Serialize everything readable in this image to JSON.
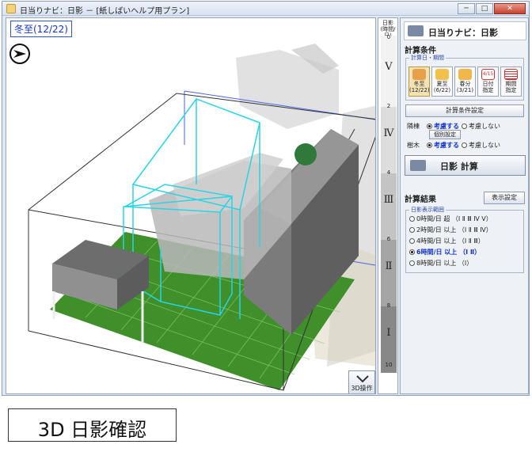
{
  "window": {
    "title": "日当りナビ：日影 － [紙しばいヘルプ用プラン]",
    "buttons": [
      "─",
      "□",
      "✕"
    ]
  },
  "viewport": {
    "date_label": "冬至(12/22)",
    "op_button_label": "3D操作"
  },
  "scale": {
    "header": [
      "日影",
      "(時間/日)"
    ],
    "numbers": [
      "0",
      "2",
      "4",
      "6",
      "8",
      "10"
    ],
    "romans": [
      "Ⅴ",
      "Ⅳ",
      "Ⅲ",
      "Ⅱ",
      "Ⅰ"
    ]
  },
  "panel": {
    "title": "日当りナビ：日影",
    "calc_conditions": {
      "heading": "計算条件",
      "group_label": "計算日・期間",
      "days": [
        {
          "label": "冬至",
          "date": "(12/22)",
          "active": true
        },
        {
          "label": "夏至",
          "date": "(6/22)",
          "active": false
        },
        {
          "label": "春分",
          "date": "(3/21)",
          "active": false
        },
        {
          "label": "日付",
          "date": "指定",
          "active": false
        },
        {
          "label": "期間",
          "date": "指定",
          "active": false
        }
      ],
      "day_icon_text": "4/15",
      "settings_button": "計算条件設定",
      "neighbor": {
        "key": "隣棟",
        "consider": "考慮する",
        "ignore": "考慮しない"
      },
      "individual_button": "個別設定",
      "trees": {
        "key": "樹木",
        "consider": "考慮する",
        "ignore": "考慮しない"
      }
    },
    "calc_button": "日影 計算",
    "results": {
      "heading": "計算結果",
      "display_button": "表示設定",
      "group_label": "日影表示範囲",
      "rows": [
        {
          "text": "0時間/日 超",
          "range": "（Ⅰ Ⅱ Ⅲ Ⅳ Ⅴ）",
          "selected": false
        },
        {
          "text": "2時間/日 以上",
          "range": "（Ⅰ Ⅱ Ⅲ Ⅳ）",
          "selected": false
        },
        {
          "text": "4時間/日 以上",
          "range": "（Ⅰ Ⅱ Ⅲ）",
          "selected": false
        },
        {
          "text": "6時間/日 以上",
          "range": "（Ⅰ Ⅱ）",
          "selected": true
        },
        {
          "text": "8時間/日 以上",
          "range": "（Ⅰ）",
          "selected": false
        }
      ]
    }
  },
  "caption": "3D 日影確認",
  "colors": {
    "selection_blue": "#1133cc",
    "wire_cyan": "#28d4e6",
    "lawn_green": "#3f8f2a",
    "building_gray": "#7b7b7b"
  }
}
